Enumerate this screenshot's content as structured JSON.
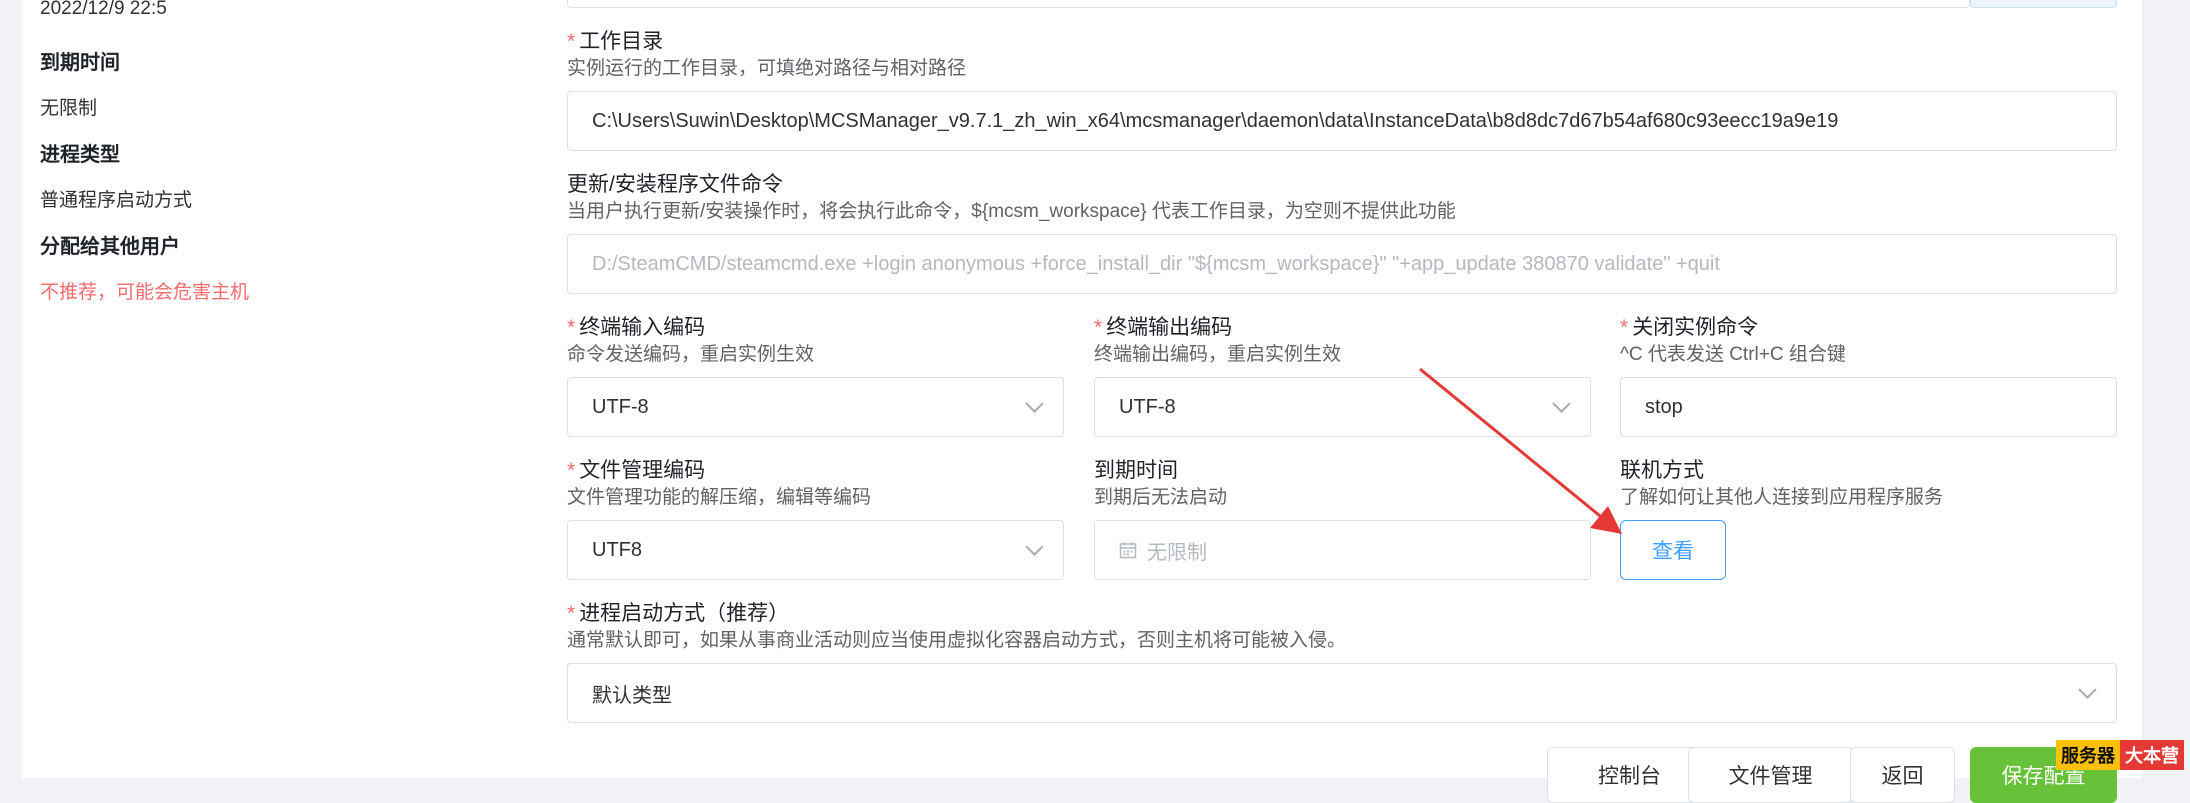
{
  "info": {
    "date_partial": "2022/12/9 22:5",
    "expire_label": "到期时间",
    "expire_value": "无限制",
    "process_type_label": "进程类型",
    "process_type_value": "普通程序启动方式",
    "assign_label": "分配给其他用户",
    "assign_value": "不推荐，可能会危害主机"
  },
  "form": {
    "workdir": {
      "label": "工作目录",
      "desc": "实例运行的工作目录，可填绝对路径与相对路径",
      "value": "C:\\Users\\Suwin\\Desktop\\MCSManager_v9.7.1_zh_win_x64\\mcsmanager\\daemon\\data\\InstanceData\\b8d8dc7d67b54af680c93eecc19a9e19"
    },
    "update_cmd": {
      "label": "更新/安装程序文件命令",
      "desc": "当用户执行更新/安装操作时，将会执行此命令，${mcsm_workspace} 代表工作目录，为空则不提供此功能",
      "placeholder": "D:/SteamCMD/steamcmd.exe +login anonymous +force_install_dir \"${mcsm_workspace}\" \"+app_update 380870 validate\" +quit"
    },
    "input_encoding": {
      "label": "终端输入编码",
      "desc": "命令发送编码，重启实例生效",
      "value": "UTF-8"
    },
    "output_encoding": {
      "label": "终端输出编码",
      "desc": "终端输出编码，重启实例生效",
      "value": "UTF-8"
    },
    "stop_cmd": {
      "label": "关闭实例命令",
      "desc": "^C 代表发送 Ctrl+C 组合键",
      "value": "stop"
    },
    "file_encoding": {
      "label": "文件管理编码",
      "desc": "文件管理功能的解压缩，编辑等编码",
      "value": "UTF8"
    },
    "expire_time": {
      "label": "到期时间",
      "desc": "到期后无法启动",
      "placeholder": "无限制"
    },
    "network": {
      "label": "联机方式",
      "desc": "了解如何让其他人连接到应用程序服务",
      "button": "查看"
    },
    "process_mode": {
      "label": "进程启动方式（推荐）",
      "desc": "通常默认即可，如果从事商业活动则应当使用虚拟化容器启动方式，否则主机将可能被入侵。",
      "value": "默认类型"
    }
  },
  "actions": {
    "console": "控制台",
    "file_manager": "文件管理",
    "back": "返回",
    "save": "保存配置"
  },
  "watermark": {
    "part1": "服务器",
    "part2": "大本营"
  },
  "colors": {
    "required": "#f56c6c",
    "link": "#409eff",
    "primary": "#67c23a",
    "annotation_arrow": "#e53935"
  }
}
